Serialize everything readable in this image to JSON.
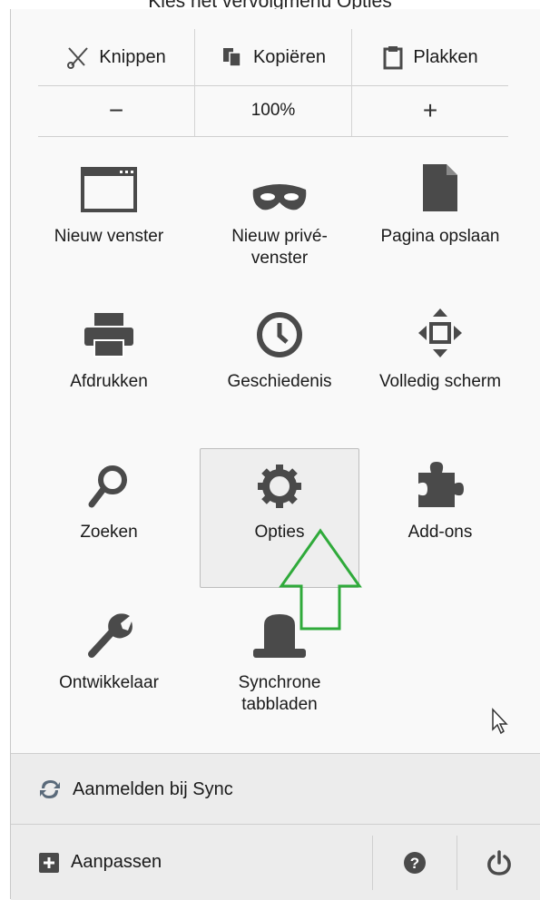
{
  "caption": "Kies het vervolgmenu Opties",
  "edit": {
    "cut_label": "Knippen",
    "copy_label": "Kopiëren",
    "paste_label": "Plakken"
  },
  "zoom": {
    "minus": "−",
    "level": "100%",
    "plus": "+"
  },
  "menu_items": [
    {
      "label": "Nieuw venster",
      "icon": "window-icon"
    },
    {
      "label": "Nieuw privé-venster",
      "icon": "mask-icon"
    },
    {
      "label": "Pagina opslaan",
      "icon": "page-icon"
    },
    {
      "label": "Afdrukken",
      "icon": "printer-icon"
    },
    {
      "label": "Geschiedenis",
      "icon": "clock-icon"
    },
    {
      "label": "Volledig scherm",
      "icon": "fullscreen-icon"
    },
    {
      "label": "Zoeken",
      "icon": "search-icon"
    },
    {
      "label": "Opties",
      "icon": "gear-icon",
      "selected": true
    },
    {
      "label": "Add-ons",
      "icon": "puzzle-icon"
    },
    {
      "label": "Ontwikkelaar",
      "icon": "wrench-icon"
    },
    {
      "label": "Synchrone tabbladen",
      "icon": "hat-icon"
    }
  ],
  "sync": {
    "label": "Aanmelden bij Sync",
    "icon": "sync-icon"
  },
  "footer": {
    "customize_label": "Aanpassen",
    "customize_icon": "plus-box-icon",
    "help_icon": "help-icon",
    "quit_icon": "power-icon"
  },
  "colors": {
    "icon": "#4a4a4a",
    "arrow": "#2faa3a"
  }
}
